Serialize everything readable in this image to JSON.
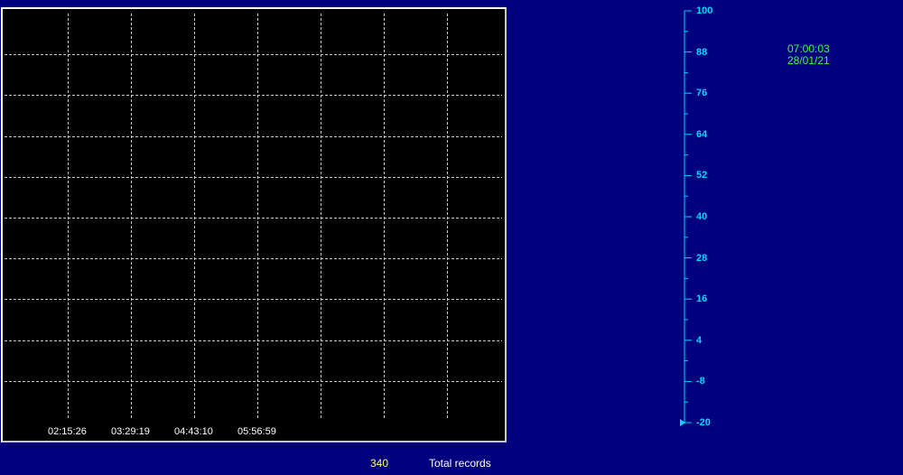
{
  "colors": {
    "background": "#00007f",
    "plot_background": "#000000",
    "grid": "#c8c8c8",
    "axis": "#00d8ff",
    "clock": "#3cff3c",
    "count": "#ffff66"
  },
  "chart_data": {
    "type": "line",
    "series": [],
    "x_tick_labels": [
      "02:15:26",
      "03:29:19",
      "04:43:10",
      "05:56:59"
    ],
    "y_ticks": [
      100,
      88,
      76,
      64,
      52,
      40,
      28,
      16,
      4,
      -8,
      -20
    ],
    "ylim": [
      -20,
      100
    ],
    "grid": true,
    "grid_columns": 8,
    "grid_rows": 10
  },
  "clock": {
    "time": "07:00:03",
    "date": "28/01/21"
  },
  "status": {
    "record_count": "340",
    "record_label": "Total records"
  },
  "icons": {
    "axis_marker": "triangle-right-icon"
  }
}
